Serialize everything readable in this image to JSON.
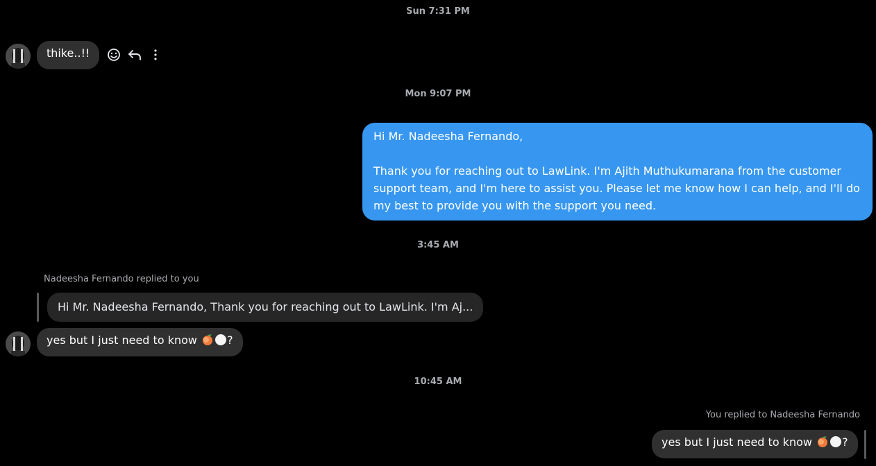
{
  "timestamps": {
    "sun": "Sun 7:31 PM",
    "mon": "Mon 9:07 PM",
    "t345": "3:45 AM",
    "t1045": "10:45 AM"
  },
  "messages": {
    "first_incoming": "thike..!!",
    "outgoing_greeting": "Hi Mr. Nadeesha Fernando,",
    "outgoing_body": "Thank you for reaching out to LawLink. I'm Ajith Muthukumarana from the customer support team, and I'm here to assist you. Please let me know how I can help, and I'll do my best to provide you with the support you need.",
    "reply_label_in": "Nadeesha Fernando replied to you",
    "quoted_in": "Hi Mr. Nadeesha Fernando, Thank you for reaching out to LawLink. I'm Aj...",
    "incoming_question": "yes but I just need to know",
    "incoming_question_end": "?",
    "reply_label_out": "You replied to Nadeesha Fernando",
    "outgoing_reply": "yes but I just need to know",
    "outgoing_reply_end": "?"
  },
  "icons": {
    "react": "smiley-face-icon",
    "reply": "reply-arrow-icon",
    "more": "more-vertical-icon",
    "emoji_1": "peach-emoji",
    "emoji_2": "white-circle-emoji"
  },
  "colors": {
    "background": "#000000",
    "incoming_bubble": "#303030",
    "outgoing_bubble": "#3797f0",
    "timestamp_text": "#a8abb0"
  }
}
